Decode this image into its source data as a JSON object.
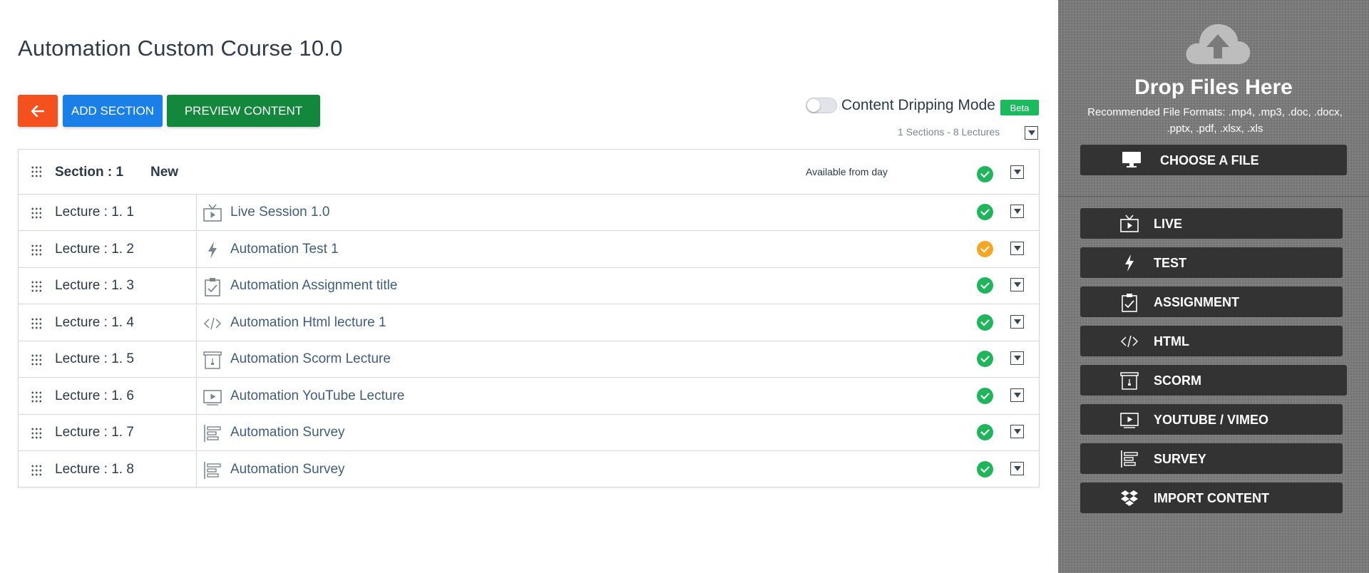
{
  "page": {
    "title": "Automation Custom Course 10.0"
  },
  "toolbar": {
    "back_icon": "arrow-left-icon",
    "add_section_label": "ADD SECTION",
    "preview_content_label": "PREVIEW CONTENT",
    "dripping_label": "Content Dripping Mode",
    "dripping_enabled": false,
    "beta_badge": "Beta",
    "summary": "1 Sections - 8 Lectures"
  },
  "section": {
    "label": "Section : 1",
    "name": "New",
    "available_label": "Available from day",
    "status": "complete"
  },
  "lectures": [
    {
      "num": "Lecture : 1. 1",
      "title": "Live Session 1.0",
      "icon": "live-tv-icon",
      "status": "complete"
    },
    {
      "num": "Lecture : 1. 2",
      "title": "Automation Test 1",
      "icon": "lightning-icon",
      "status": "warning"
    },
    {
      "num": "Lecture : 1. 3",
      "title": "Automation Assignment title",
      "icon": "clipboard-check-icon",
      "status": "complete"
    },
    {
      "num": "Lecture : 1. 4",
      "title": "Automation Html lecture 1",
      "icon": "code-icon",
      "status": "complete"
    },
    {
      "num": "Lecture : 1. 5",
      "title": "Automation Scorm Lecture",
      "icon": "scorm-box-icon",
      "status": "complete"
    },
    {
      "num": "Lecture : 1. 6",
      "title": "Automation YouTube Lecture",
      "icon": "video-play-icon",
      "status": "complete"
    },
    {
      "num": "Lecture : 1. 7",
      "title": "Automation Survey",
      "icon": "survey-bars-icon",
      "status": "complete"
    },
    {
      "num": "Lecture : 1. 8",
      "title": "Automation Survey",
      "icon": "survey-bars-icon",
      "status": "complete"
    }
  ],
  "sidebar": {
    "drop_title": "Drop Files Here",
    "formats": "Recommended File Formats: .mp4, .mp3, .doc, .docx, .pptx, .pdf, .xlsx, .xls",
    "choose_label": "CHOOSE A FILE",
    "buttons": [
      {
        "label": "LIVE",
        "icon": "live-tv-icon"
      },
      {
        "label": "TEST",
        "icon": "lightning-icon"
      },
      {
        "label": "ASSIGNMENT",
        "icon": "clipboard-check-icon"
      },
      {
        "label": "HTML",
        "icon": "code-icon"
      },
      {
        "label": "SCORM",
        "icon": "scorm-box-icon"
      },
      {
        "label": "YOUTUBE / VIMEO",
        "icon": "video-play-icon"
      },
      {
        "label": "SURVEY",
        "icon": "survey-bars-icon"
      },
      {
        "label": "IMPORT CONTENT",
        "icon": "dropbox-icon"
      }
    ]
  },
  "colors": {
    "back": "#f4511e",
    "add": "#1a7fe6",
    "preview": "#13873c",
    "complete": "#1fb55a",
    "warning": "#f5a623",
    "beta": "#1abb5c"
  }
}
